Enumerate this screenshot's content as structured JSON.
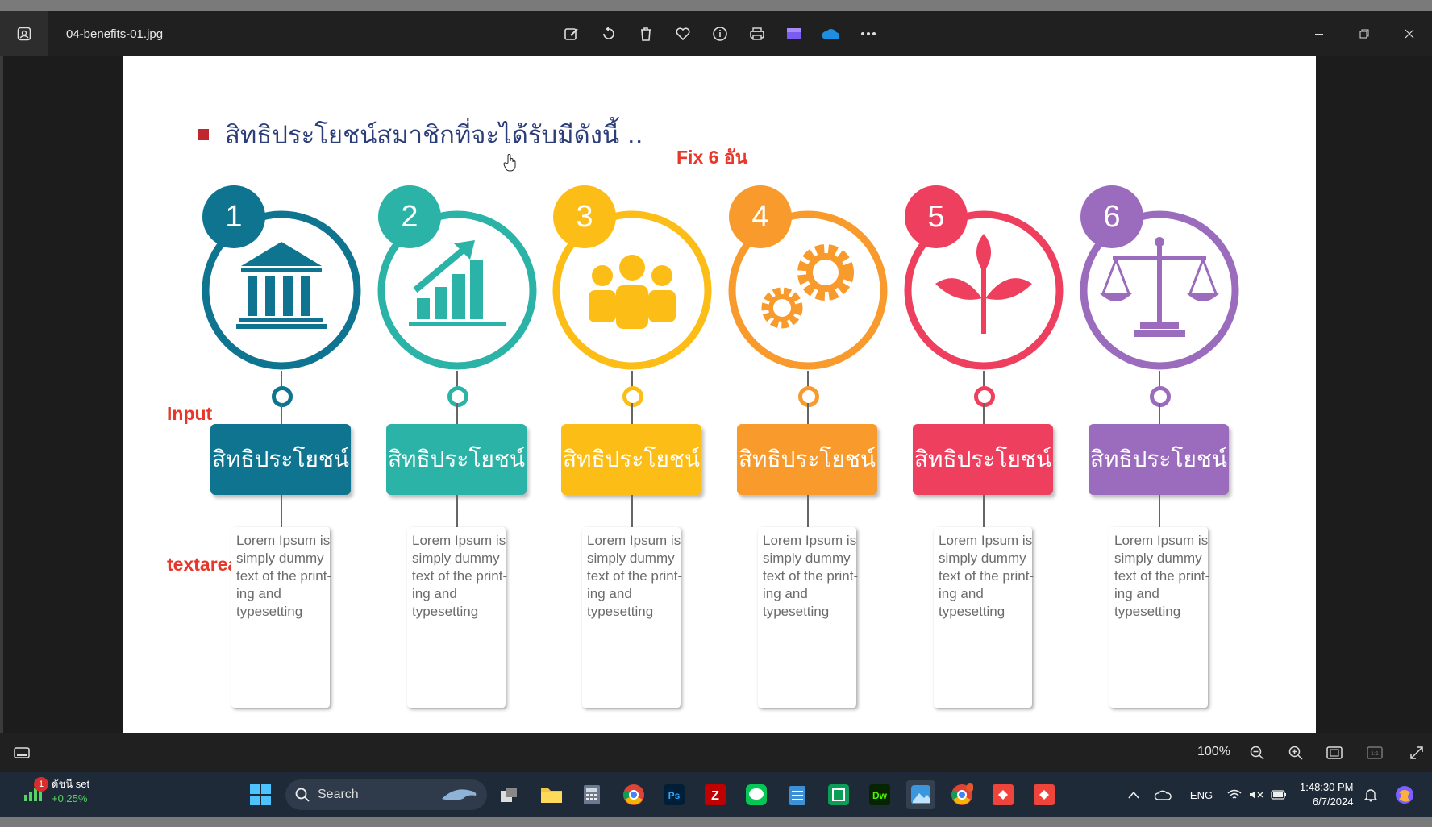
{
  "window": {
    "file_title": "04-benefits-01.jpg"
  },
  "toolbar": {
    "buttons": [
      "edit-image-icon",
      "rotate-icon",
      "delete-icon",
      "favorite-icon",
      "info-icon",
      "print-icon",
      "clipchamp-icon",
      "onedrive-icon",
      "more-icon"
    ]
  },
  "slide": {
    "heading": "สิทธิประโยชน์สมาชิกที่จะได้รับมีดังนี้ ..",
    "annotation_top": "Fix 6 อัน",
    "annotation_input": "Input",
    "annotation_textarea": "textarea",
    "colors": {
      "c1": "#0e7490",
      "c2": "#2bb3a7",
      "c3": "#fbbd16",
      "c4": "#f89a2c",
      "c5": "#ef3f5e",
      "c6": "#9b6cbd"
    },
    "items": [
      {
        "num": "1",
        "label": "สิทธิประโยชน์",
        "icon": "bank-icon",
        "text": "Lorem Ipsum is simply dummy text of the print- ing and typesetting"
      },
      {
        "num": "2",
        "label": "สิทธิประโยชน์",
        "icon": "growth-chart-icon",
        "text": "Lorem Ipsum is simply dummy text of the print- ing and typesetting"
      },
      {
        "num": "3",
        "label": "สิทธิประโยชน์",
        "icon": "people-icon",
        "text": "Lorem Ipsum is simply dummy text of the print- ing and typesetting"
      },
      {
        "num": "4",
        "label": "สิทธิประโยชน์",
        "icon": "gears-icon",
        "text": "Lorem Ipsum is simply dummy text of the print- ing and typesetting"
      },
      {
        "num": "5",
        "label": "สิทธิประโยชน์",
        "icon": "plant-icon",
        "text": "Lorem Ipsum is simply dummy text of the print- ing and typesetting"
      },
      {
        "num": "6",
        "label": "สิทธิประโยชน์",
        "icon": "scales-icon",
        "text": "Lorem Ipsum is simply dummy text of the print- ing and typesetting"
      }
    ]
  },
  "viewer_bar": {
    "zoom": "100%"
  },
  "taskbar": {
    "stock_name": "ดัชนี set",
    "stock_change": "+0.25%",
    "stock_badge": "1",
    "search_placeholder": "Search",
    "language": "ENG",
    "time": "1:48:30 PM",
    "date": "6/7/2024"
  }
}
